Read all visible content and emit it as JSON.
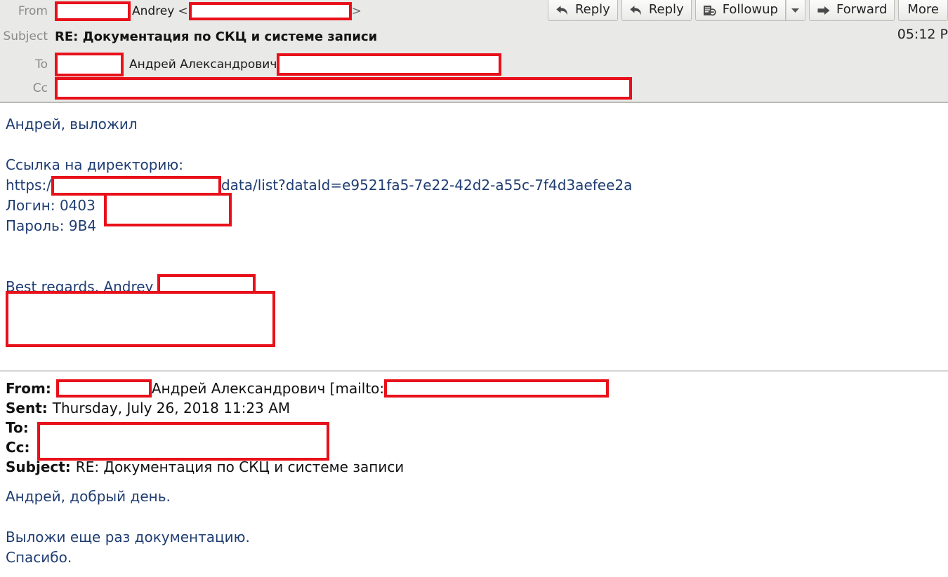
{
  "toolbar": {
    "buttons": [
      {
        "name": "reply-button",
        "label": "Reply",
        "icon": "reply-arrow-icon"
      },
      {
        "name": "reply-all-button",
        "label": "Reply",
        "icon": "reply-arrow-icon"
      },
      {
        "name": "followup-button",
        "label": "Followup",
        "icon": "followup-icon"
      },
      {
        "name": "forward-button",
        "label": "Forward",
        "icon": "forward-arrow-icon"
      },
      {
        "name": "more-button",
        "label": "More",
        "icon": "none"
      }
    ],
    "dropdown_icon": "chevron-down-icon"
  },
  "header": {
    "labels": {
      "from": "From",
      "subject": "Subject",
      "to": "To",
      "cc": "Cc"
    },
    "from": {
      "redacted_name": "",
      "display_name": "Andrey",
      "open_bracket": "<",
      "redacted_address": "",
      "close_bracket": ">"
    },
    "subject": "RE: Документация по СКЦ и системе записи",
    "to": {
      "redacted_prefix": "",
      "display_name": "Андрей Александрович",
      "redacted_address": ""
    },
    "cc": {
      "redacted_address": ""
    },
    "timestamp": "05:12 P"
  },
  "body": {
    "greeting": "Андрей, выложил",
    "link_caption": "Ссылка на директорию:",
    "url_prefix": "https:/",
    "url_redacted": "",
    "url_suffix": "data/list?dataId=e9521fa5-7e22-42d2-a55c-7f4d3aefee2a",
    "login_label": "Логин: 0403",
    "login_redacted": "",
    "password_label": "Пароль: 9В4",
    "password_redacted": "",
    "signoff": "Best regards, Andrey",
    "signoff_redacted": "",
    "signature_redacted": ""
  },
  "quoted": {
    "from_key": "From:",
    "from_redacted": "",
    "from_name": "Андрей Александрович [mailto:",
    "from_mail_redacted": "",
    "sent_key": "Sent:",
    "sent_value": "Thursday, July 26, 2018 11:23 AM",
    "to_key": "To:",
    "to_redacted": "",
    "cc_key": "Cc:",
    "cc_redacted": "",
    "subject_key": "Subject:",
    "subject_value": "RE: Документация по СКЦ и системе записи",
    "body_greeting": "Андрей, добрый день.",
    "body_line1": "Выложи еще раз документацию.",
    "body_line2": "Спасибо."
  },
  "colors": {
    "redaction_border": "#e8101a",
    "body_text": "#1f3d72",
    "header_bg": "#e9e9e7"
  }
}
